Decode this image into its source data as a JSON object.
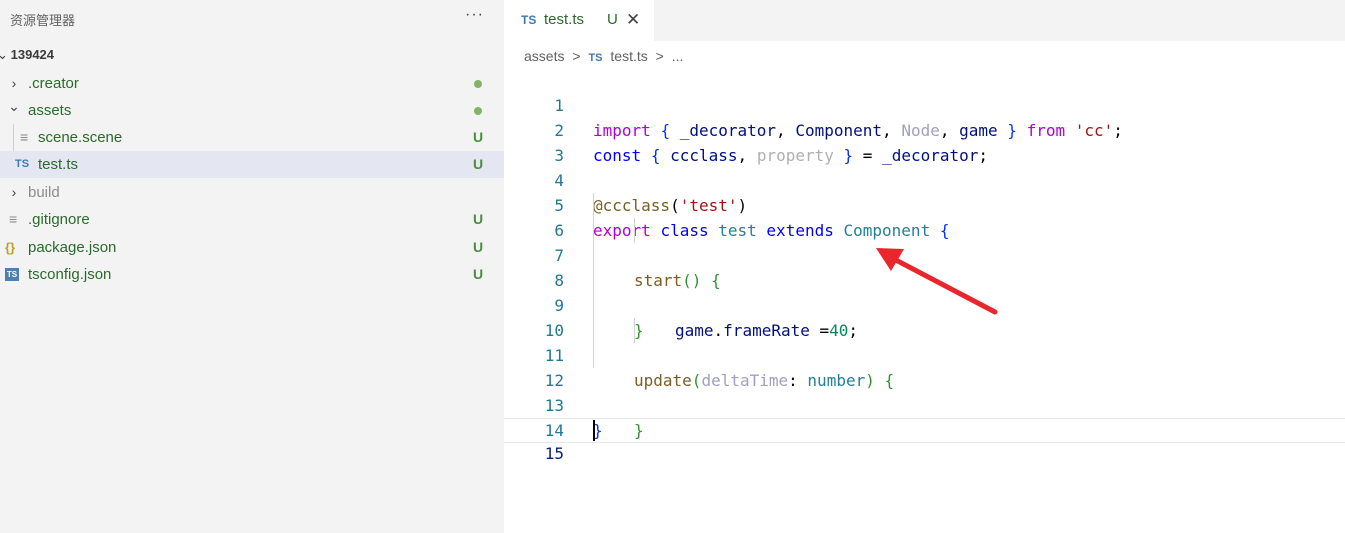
{
  "sidebar": {
    "title": "资源管理器",
    "more": "···",
    "root": "139424",
    "items": [
      {
        "label": ".creator",
        "chevron": "›",
        "icon": "",
        "status": "",
        "dot": true
      },
      {
        "label": "assets",
        "chevron": "⌄",
        "icon": "",
        "status": "",
        "dot": true
      },
      {
        "label": "scene.scene",
        "chevron": "",
        "icon": "≡",
        "status": "U",
        "dot": false
      },
      {
        "label": "test.ts",
        "chevron": "",
        "icon": "TS",
        "status": "U",
        "dot": false
      },
      {
        "label": "build",
        "chevron": "›",
        "icon": "",
        "status": "",
        "dot": false
      },
      {
        "label": ".gitignore",
        "chevron": "",
        "icon": "≡",
        "status": "U",
        "dot": false
      },
      {
        "label": "package.json",
        "chevron": "",
        "icon": "{}",
        "status": "U",
        "dot": false
      },
      {
        "label": "tsconfig.json",
        "chevron": "",
        "icon": "TS",
        "status": "U",
        "dot": false
      }
    ]
  },
  "tab": {
    "badge": "TS",
    "label": "test.ts",
    "status": "U",
    "close": "✕"
  },
  "breadcrumb": {
    "folder": "assets",
    "sep": ">",
    "badge": "TS",
    "file": "test.ts",
    "more": "..."
  },
  "code": {
    "line_numbers": [
      "1",
      "2",
      "3",
      "4",
      "5",
      "6",
      "7",
      "8",
      "9",
      "10",
      "11",
      "12",
      "13",
      "14",
      "15"
    ],
    "l1": {
      "import": "import",
      "open": "{",
      "a": "_decorator",
      "c1": ",",
      "b": "Component",
      "c2": ",",
      "c": "Node",
      "c3": ",",
      "d": "game",
      "close": "}",
      "from": "from",
      "str": "'cc'",
      "end": ";"
    },
    "l2": {
      "const": "const",
      "open": "{",
      "a": "ccclass",
      "c1": ",",
      "b": "property",
      "close": "}",
      "eq": "=",
      "c": "_decorator",
      "end": ";"
    },
    "l4": {
      "at": "@ccclass",
      "po": "(",
      "str": "'test'",
      "pc": ")"
    },
    "l5": {
      "export": "export",
      "cls": "class",
      "name": "test",
      "ext": "extends",
      "base": "Component",
      "brace": "{"
    },
    "l6": {
      "fn": "start",
      "parens": "()",
      "brace": "{"
    },
    "l7": {
      "obj": "game",
      "dot": ".",
      "prop": "frameRate",
      "eq": " =",
      "num": "40",
      "end": ";"
    },
    "l8": {
      "brace": "}"
    },
    "l10": {
      "fn": "update",
      "po": "(",
      "param": "deltaTime",
      "colon": ":",
      "type": "number",
      "pc": ")",
      "brace": "{"
    },
    "l12": {
      "brace": "}"
    },
    "l13": {
      "brace": "}"
    }
  },
  "annotation": {
    "color": "#e8262b"
  }
}
